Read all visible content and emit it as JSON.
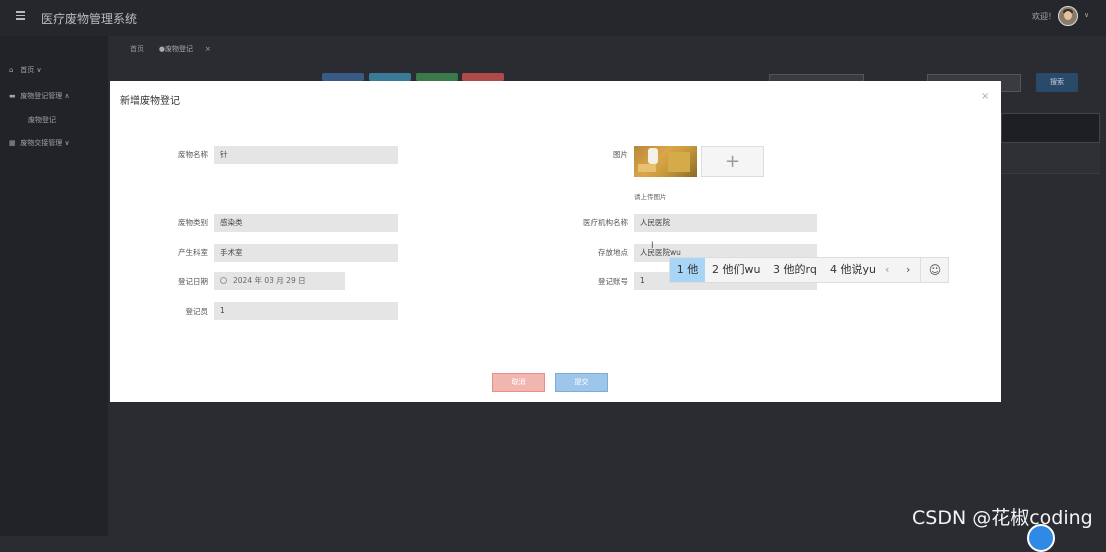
{
  "app": {
    "title": "医疗废物管理系统",
    "welcome": "欢迎！"
  },
  "sidebar": {
    "items": [
      {
        "label": "首页",
        "icon": "home-icon",
        "glyph": "⌂",
        "caret": "∨"
      },
      {
        "label": "废物登记管理",
        "icon": "document-icon",
        "glyph": "▬",
        "caret": "∧"
      },
      {
        "label": "废物登记",
        "icon": "",
        "glyph": "",
        "caret": ""
      },
      {
        "label": "废物交接管理",
        "icon": "grid-icon",
        "glyph": "▦",
        "caret": "∨"
      }
    ]
  },
  "tabs": [
    {
      "label": "首页"
    },
    {
      "label": "●废物登记"
    }
  ],
  "behind": {
    "search_button": "搜索",
    "button_colors": [
      "#3a5a86",
      "#3a7a96",
      "#3a7a4a",
      "#b04a4a"
    ]
  },
  "dialog": {
    "title": "新增废物登记",
    "close": "×",
    "fields": {
      "waste_name": {
        "label": "废物名称",
        "value": "针"
      },
      "waste_type": {
        "label": "废物类别",
        "value": "感染类"
      },
      "department": {
        "label": "产生科室",
        "value": "手术室"
      },
      "date": {
        "label": "登记日期",
        "value": "2024 年 03 月 29 日"
      },
      "registrar": {
        "label": "登记员",
        "value": "1"
      },
      "image": {
        "label": "图片",
        "tip": "请上传图片",
        "plus": "+"
      },
      "institution": {
        "label": "医疗机构名称",
        "value": "人民医院"
      },
      "storage": {
        "label": "存放地点",
        "value": "人民医院wu"
      },
      "account": {
        "label": "登记账号",
        "value": "1"
      }
    },
    "buttons": {
      "cancel": "取消",
      "submit": "提交"
    }
  },
  "ime": {
    "candidates": [
      "1 他",
      "2 他们wu",
      "3 他的rq",
      "4 他说yu"
    ],
    "prev": "‹",
    "next": "›",
    "emoji": "☺"
  },
  "watermark": "CSDN @花椒coding",
  "colors": {
    "cancel": "#f2b6b0",
    "submit": "#9ec6ea",
    "ime_selected": "#a8d4f5"
  }
}
